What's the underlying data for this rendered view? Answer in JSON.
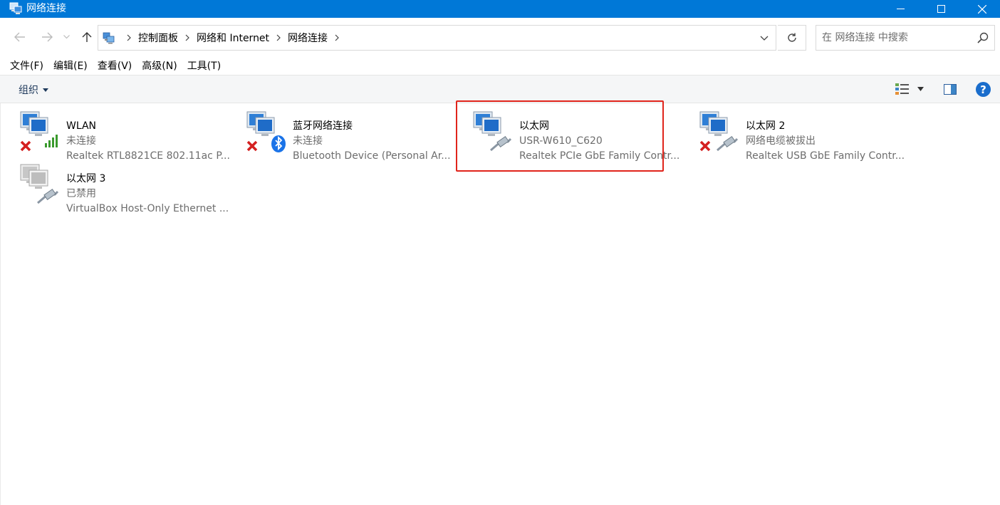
{
  "colors": {
    "accent": "#0078d7",
    "cmdbar": "#f5f6f7",
    "highlight": "#e0241b"
  },
  "window": {
    "title": "网络连接",
    "minimize_icon": "minimize-icon",
    "maximize_icon": "maximize-icon",
    "close_icon": "close-icon"
  },
  "address": {
    "crumbs": [
      "控制面板",
      "网络和 Internet",
      "网络连接"
    ],
    "search_placeholder": "在 网络连接 中搜索"
  },
  "menu": [
    "文件(F)",
    "编辑(E)",
    "查看(V)",
    "高级(N)",
    "工具(T)"
  ],
  "toolbar": {
    "organize_label": "组织"
  },
  "connections": [
    {
      "name": "WLAN",
      "status": "未连接",
      "device": "Realtek RTL8821CE 802.11ac P...",
      "overlay": "red-x",
      "type": "wifi"
    },
    {
      "name": "蓝牙网络连接",
      "status": "未连接",
      "device": "Bluetooth Device (Personal Ar...",
      "overlay": "red-x",
      "type": "bluetooth"
    },
    {
      "name": "以太网",
      "status": "USR-W610_C620",
      "device": "Realtek PCIe GbE Family Contr...",
      "overlay": "none",
      "type": "ethernet"
    },
    {
      "name": "以太网 2",
      "status": "网络电缆被拔出",
      "device": "Realtek USB GbE Family Contr...",
      "overlay": "red-x",
      "type": "ethernet"
    },
    {
      "name": "以太网 3",
      "status": "已禁用",
      "device": "VirtualBox Host-Only Ethernet ...",
      "overlay": "none",
      "type": "ethernet-disabled"
    }
  ]
}
